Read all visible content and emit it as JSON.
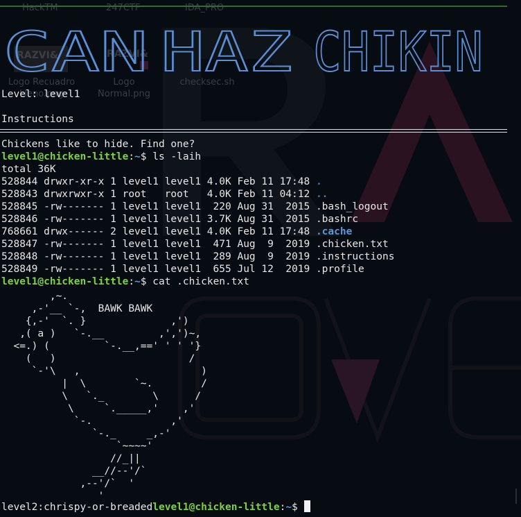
{
  "desktop": {
    "tabs": [
      "HackTM",
      "247CTF",
      "IDA_PRO"
    ],
    "icons": [
      {
        "line1": "Logo Recuadro",
        "line2": "Lleno.png",
        "logo_text": "RAZVI&"
      },
      {
        "line1": "Logo",
        "line2": "Normal.png",
        "logo_text": "RAZVI&"
      },
      {
        "line1": "checksec.sh",
        "line2": ""
      }
    ]
  },
  "banner": {
    "words": [
      "CAN",
      "HAZ",
      "CHIKIN"
    ]
  },
  "header": {
    "level_line": "Level: level1",
    "section_title": "Instructions"
  },
  "session": {
    "intro": "Chickens like to hide. Find one?",
    "user": "level1@chicken-little",
    "sep": ":",
    "path": "~",
    "dollar": "$ ",
    "cmd1": "ls -laih",
    "total": "total 36K",
    "ls_rows": [
      {
        "meta": "528844 drwxr-xr-x 1 level1 level1 4.0K Feb 11 17:48 ",
        "name": "."
      },
      {
        "meta": "528843 drwxrwxr-x 1 root   root   4.0K Feb 11 04:12 ",
        "name": ".."
      },
      {
        "meta": "528845 -rw------- 1 level1 level1  220 Aug 31  2015 ",
        "name": ".bash_logout"
      },
      {
        "meta": "528846 -rw------- 1 level1 level1 3.7K Aug 31  2015 ",
        "name": ".bashrc"
      },
      {
        "meta": "768661 drwx------ 2 level1 level1 4.0K Feb 11 17:48 ",
        "name": ".cache"
      },
      {
        "meta": "528847 -rw------- 1 level1 level1  471 Aug  9  2019 ",
        "name": ".chicken.txt"
      },
      {
        "meta": "528848 -rw------- 1 level1 level1  289 Aug  9  2019 ",
        "name": ".instructions"
      },
      {
        "meta": "528849 -rw------- 1 level1 level1  655 Jul 12  2019 ",
        "name": ".profile"
      }
    ],
    "cmd2": "cat .chicken.txt",
    "chicken_art": "        ,~.\n     ,-'__ `-,  BAWK BAWK\n    {,-'  `. }              ,')\n   ,( a )   `-.__         ,',')~,\n  <=.) (         `-.__,==' ' ' '}\n    (   )                      /\n     `-'\\   ,                    )\n          |  \\        `~.        /\n          \\   `._        \\      /\n           \\     `._____,'    ,'\n            `-.             ,'\n               `-._     _,-'\n                   `~~~~'\n                  //_||\n               __//--'/`\n             ,--'/`  '\n                '",
    "flag_output": "level2:chrispy-or-breaded",
    "final_user": "level1@chicken-little",
    "final_path": "~"
  },
  "colors": {
    "background": "#070b12",
    "prompt_user": "#7cd33b",
    "prompt_path": "#5d97d6",
    "directory": "#5d97d6",
    "banner": "#5b8fd6",
    "rule": "#2f6f2b"
  }
}
